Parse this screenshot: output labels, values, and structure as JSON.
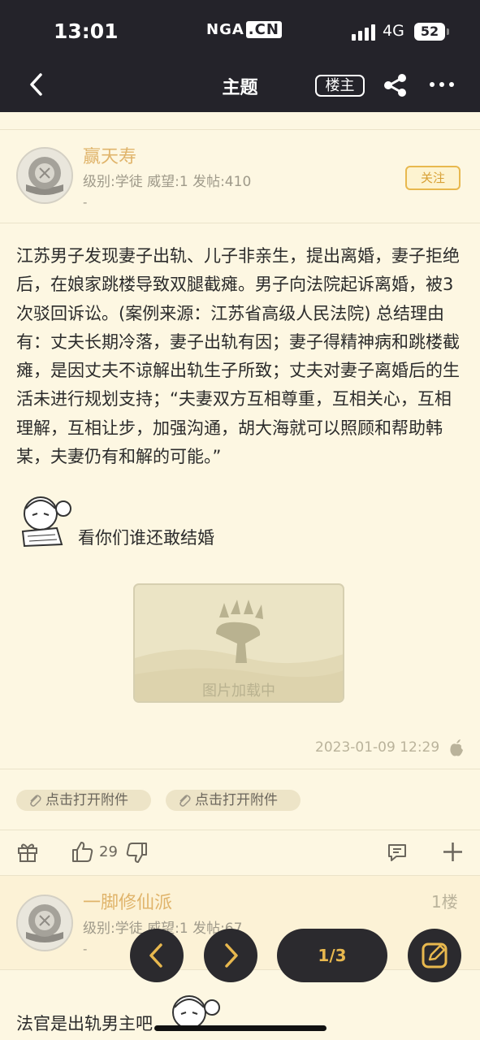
{
  "status_bar": {
    "time": "13:01",
    "logo_main": "NGA",
    "logo_suffix": ".CN",
    "network": "4G",
    "battery": "52"
  },
  "nav": {
    "title": "主题",
    "op_button": "楼主",
    "icons": [
      "back-icon",
      "share-icon",
      "more-icon"
    ]
  },
  "posts": [
    {
      "user": {
        "name": "赢天寿",
        "meta": "级别:学徒   威望:1   发帖:410",
        "dash": "-"
      },
      "follow_label": "关注",
      "body": "江苏男子发现妻子出轨、儿子非亲生，提出离婚，妻子拒绝后，在娘家跳楼导致双腿截瘫。男子向法院起诉离婚，被3次驳回诉讼。(案例来源：江苏省高级人民法院) 总结理由有：丈夫长期冷落，妻子出轨有因；妻子得精神病和跳楼截瘫，是因丈夫不谅解出轨生子所致；丈夫对妻子离婚后的生活未进行规划支持；“夫妻双方互相尊重，互相关心，互相理解，互相让步，加强沟通，胡大海就可以照顾和帮助韩某，夫妻仍有和解的可能。”",
      "sticker_caption": "看你们谁还敢结婚",
      "image_caption": "图片加载中",
      "time": "2023-01-09 12:29",
      "attachments": [
        "点击打开附件",
        "点击打开附件"
      ],
      "likes": "29"
    },
    {
      "user": {
        "name": "一脚修仙派",
        "meta": "级别:学徒   威望:1   发帖:67",
        "dash": "-"
      },
      "floor": "1楼",
      "body_start": "法官是出轨男主吧"
    }
  ],
  "pager": {
    "label": "1/3"
  },
  "colors": {
    "accent": "#e8b84e",
    "username": "#e0b46b",
    "background": "#fdf7e2",
    "topbar": "#24232a"
  }
}
